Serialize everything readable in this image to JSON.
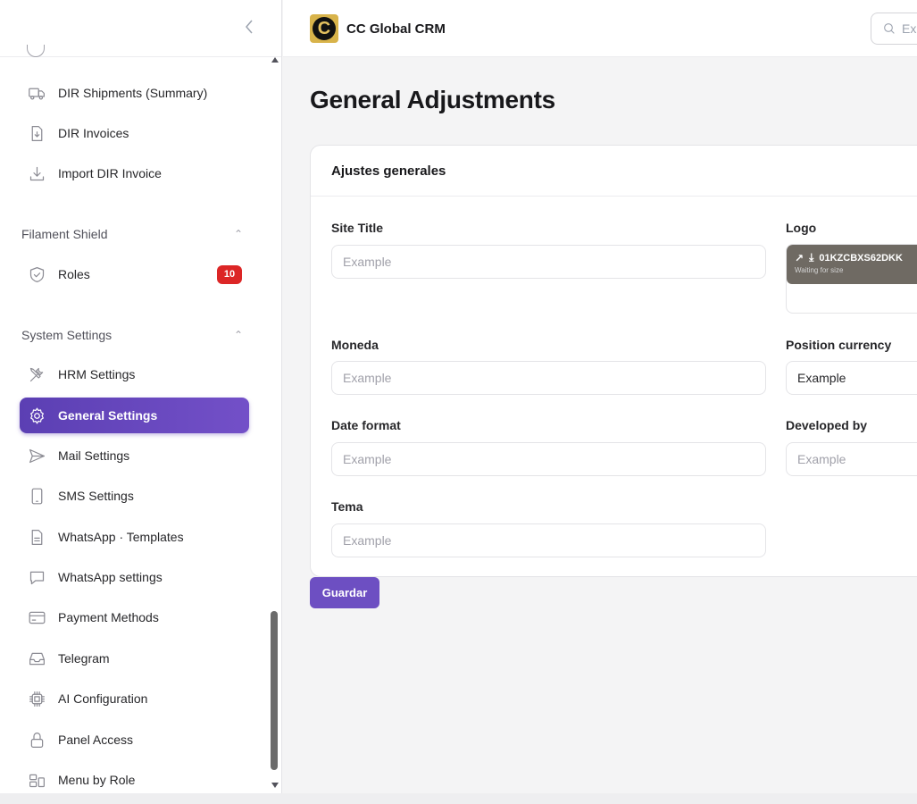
{
  "sidebar": {
    "items_top": [
      {
        "label": "DIR Shipments (Summary)",
        "icon": "truck-icon"
      },
      {
        "label": "DIR Invoices",
        "icon": "document-download-icon"
      },
      {
        "label": "Import DIR Invoice",
        "icon": "download-icon"
      }
    ],
    "group_shield": {
      "label": "Filament Shield"
    },
    "roles": {
      "label": "Roles",
      "badge": "10",
      "icon": "shield-check-icon"
    },
    "group_system": {
      "label": "System Settings"
    },
    "items_system": [
      {
        "label": "HRM Settings",
        "icon": "wrench-screwdriver-icon"
      },
      {
        "label": "General Settings",
        "icon": "cog-icon",
        "active": true
      },
      {
        "label": "Mail Settings",
        "icon": "paper-airplane-icon"
      },
      {
        "label": "SMS Settings",
        "icon": "device-phone-icon"
      },
      {
        "label": "WhatsApp · Templates",
        "icon": "document-text-icon"
      },
      {
        "label": "WhatsApp settings",
        "icon": "chat-bubble-icon"
      },
      {
        "label": "Payment Methods",
        "icon": "credit-card-icon"
      },
      {
        "label": "Telegram",
        "icon": "inbox-icon"
      },
      {
        "label": "AI Configuration",
        "icon": "cpu-chip-icon"
      },
      {
        "label": "Panel Access",
        "icon": "lock-icon"
      },
      {
        "label": "Menu by Role",
        "icon": "squares-icon"
      }
    ]
  },
  "topbar": {
    "brand": "CC Global CRM",
    "search_placeholder": "Ex"
  },
  "page": {
    "title": "General Adjustments"
  },
  "form": {
    "section_title": "Ajustes generales",
    "site_title": {
      "label": "Site Title",
      "placeholder": "Example"
    },
    "logo": {
      "label": "Logo",
      "file_name": "01KZCBXS62DKK",
      "status": "Waiting for size"
    },
    "moneda": {
      "label": "Moneda",
      "placeholder": "Example"
    },
    "position_currency": {
      "label": "Position currency",
      "value": "Example"
    },
    "date_format": {
      "label": "Date format",
      "placeholder": "Example"
    },
    "developed_by": {
      "label": "Developed by",
      "placeholder": "Example"
    },
    "tema": {
      "label": "Tema",
      "placeholder": "Example"
    },
    "save_label": "Guardar"
  },
  "colors": {
    "accent": "#6d4fc2",
    "badge": "#dc2626",
    "brand_gold": "#d8b34a"
  }
}
